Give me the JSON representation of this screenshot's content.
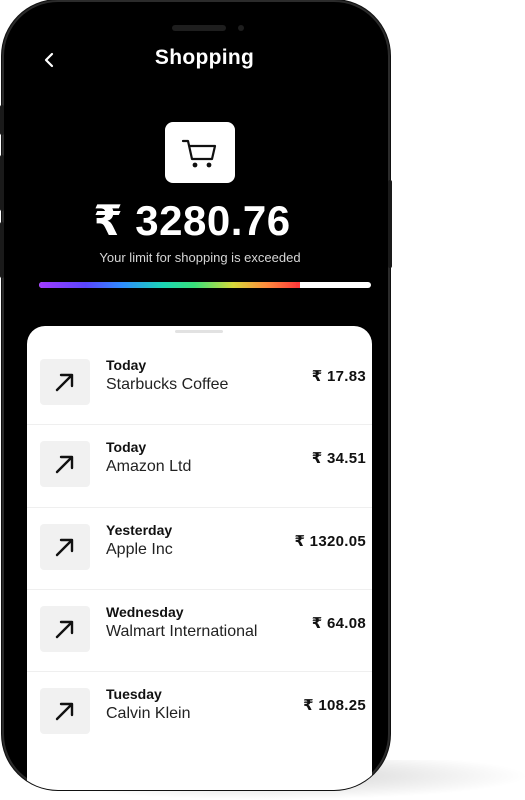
{
  "header": {
    "title": "Shopping",
    "back_icon": "chevron-left-icon"
  },
  "category": {
    "icon": "cart-icon"
  },
  "summary": {
    "amount": "₹ 3280.76",
    "limit_message": "Your limit for shopping is exceeded",
    "progress_fraction": 0.78
  },
  "transactions": [
    {
      "day": "Today",
      "name": "Starbucks Coffee",
      "amount": "₹ 17.83",
      "icon": "arrow-up-right-icon"
    },
    {
      "day": "Today",
      "name": "Amazon Ltd",
      "amount": "₹ 34.51",
      "icon": "arrow-up-right-icon"
    },
    {
      "day": "Yesterday",
      "name": "Apple Inc",
      "amount": "₹ 1320.05",
      "icon": "arrow-up-right-icon"
    },
    {
      "day": "Wednesday",
      "name": "Walmart International",
      "amount": "₹ 64.08",
      "icon": "arrow-up-right-icon"
    },
    {
      "day": "Tuesday",
      "name": "Calvin Klein",
      "amount": "₹ 108.25",
      "icon": "arrow-up-right-icon"
    }
  ],
  "colors": {
    "screen_background": "#000000",
    "sheet_background": "#ffffff",
    "progress_end": "#ff3b3b"
  }
}
